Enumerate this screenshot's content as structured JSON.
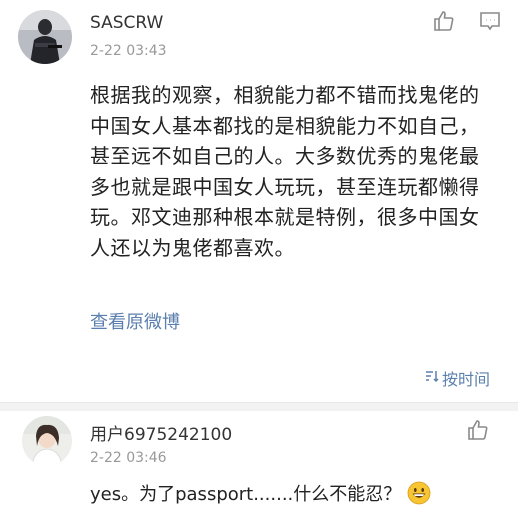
{
  "comment": {
    "username": "SASCRW",
    "time": "2-22 03:43",
    "text": "根据我的观察，相貌能力都不错而找鬼佬的中国女人基本都找的是相貌能力不如自己，甚至远不如自己的人。大多数优秀的鬼佬最多也就是跟中国女人玩玩，甚至连玩都懒得玩。邓文迪那种根本就是特例，很多中国女人还以为鬼佬都喜欢。",
    "view_original_label": "查看原微博",
    "like_icon": "thumbs-up-icon",
    "reply_icon": "comment-icon"
  },
  "sort": {
    "label": "按时间",
    "icon": "sort-icon"
  },
  "reply": {
    "username": "用户6975242100",
    "time": "2-22 03:46",
    "text": "yes。为了passport.......什么不能忍？",
    "emoji": "grinning-face-emoji",
    "like_icon": "thumbs-up-icon"
  },
  "colors": {
    "link": "#5b7fae",
    "meta": "#999999",
    "divider": "#f2f2f2"
  }
}
